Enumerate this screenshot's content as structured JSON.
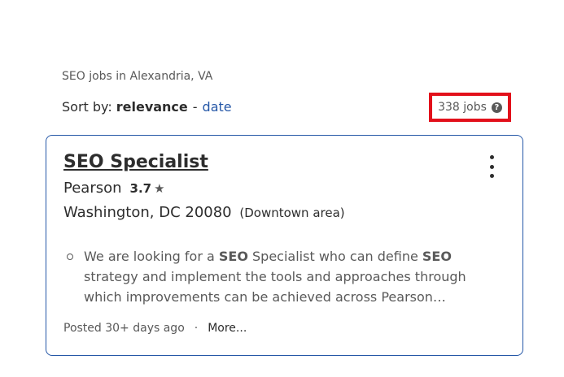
{
  "search": {
    "heading": "SEO jobs in Alexandria, VA",
    "sort_label": "Sort by:",
    "sort_active": "relevance",
    "sort_separator": "-",
    "sort_alternate": "date",
    "job_count": "338 jobs",
    "help_icon_glyph": "?"
  },
  "job": {
    "title": "SEO Specialist",
    "company": "Pearson",
    "rating": "3.7",
    "location": "Washington, DC 20080",
    "area": "(Downtown area)",
    "snippet_parts": [
      "We are looking for a ",
      "SEO",
      " Specialist who can define ",
      "SEO",
      " strategy and implement the tools and approaches through which improvements can be achieved across Pearson…"
    ],
    "posted": "Posted 30+ days ago",
    "separator": "·",
    "more_label": "More..."
  },
  "colors": {
    "link": "#2557a7",
    "highlight_box": "#e2101b",
    "card_border": "#2557a7"
  }
}
